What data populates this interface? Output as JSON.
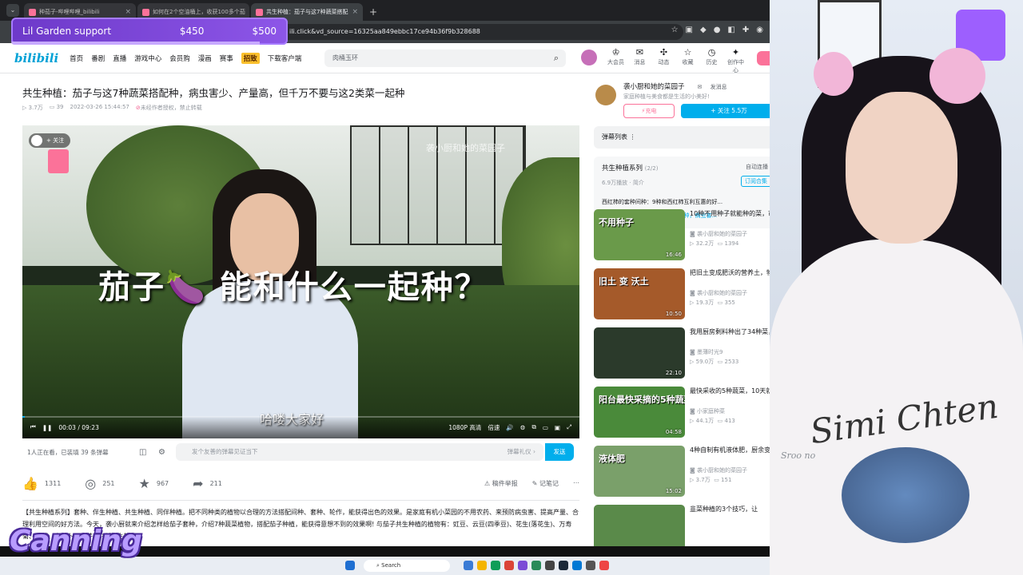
{
  "browser": {
    "tabs": [
      {
        "label": "种茄子-哔哩哔哩_bilibili"
      },
      {
        "label": "如何在2个空油桶上，收获100多个茄"
      },
      {
        "label": "共生种植：茄子与这7种蔬菜搭配"
      }
    ],
    "url": "ili.click&vd_source=16325aa849ebbc17ce94b36f9b328688"
  },
  "goal_overlay": {
    "label": "Lil Garden support",
    "current": "$450",
    "target": "$500",
    "progress": 0.9
  },
  "header": {
    "logo": "bilibili",
    "nav": [
      "首页",
      "番剧",
      "直播",
      "游戏中心",
      "会员购",
      "漫画",
      "赛事",
      "招致",
      "下载客户端"
    ],
    "search_placeholder": "肉桶玉环",
    "icons": [
      {
        "label": "大会员",
        "icon": "vip-icon"
      },
      {
        "label": "消息",
        "icon": "message-icon",
        "badge": "99+"
      },
      {
        "label": "动态",
        "icon": "dynamic-icon"
      },
      {
        "label": "收藏",
        "icon": "star-icon"
      },
      {
        "label": "历史",
        "icon": "history-icon"
      },
      {
        "label": "创作中心",
        "icon": "bulb-icon"
      }
    ]
  },
  "video": {
    "title": "共生种植：茄子与这7种蔬菜搭配种，病虫害少、产量高，但千万不要与这2类菜一起种",
    "views": "3.7万",
    "danmaku": "39",
    "date": "2022-03-26 15:44:57",
    "copyright": "未经作者授权，禁止转载",
    "caption": "茄子🍆 能和什么一起种？",
    "subtitle": "哈喽大家好",
    "watermark": "袭小厨和她的菜园子",
    "follow_label": "+ 关注",
    "time": "00:03 / 09:23",
    "progress": 0.005,
    "quality": "1080P 高清",
    "speed": "倍速"
  },
  "danmaku_bar": {
    "watching": "1人正在看，已装填 39 条弹幕",
    "placeholder": "发个友善的弹幕见证当下",
    "etiquette": "弹幕礼仪 ›",
    "send": "发送"
  },
  "actions": {
    "like": "1311",
    "coin": "251",
    "fav": "967",
    "share": "211",
    "report": "稿件举报",
    "notes": "记笔记"
  },
  "description": "【共生种植系列】套种、伴生种植、共生种植、同伴种植。把不同种类的植物以合理的方法搭配间种、套种、轮作，能获得出色的效果。是家庭有机小菜园的不用农药、来预防病虫害、提高产量、合理利用空间的好方法。今天，袭小厨就来介绍怎样给茄子套种，介绍7种蔬菜植物，搭配茄子种植，能获得意想不到的效果啊! 与茄子共生种植的植物有：豇豆、云豆(四季豆)、花生(落花生)、万寿菊、韭菜、白萝卜、欧芹(洋香菜)生姜。",
  "uploader": {
    "name": "袭小厨和她的菜园子",
    "message": "发消息",
    "desc": "家庭种植与美食都是生活的小美好!",
    "charge": "充电",
    "follow": "+ 关注 5.5万"
  },
  "danmaku_list": "弹幕列表",
  "series": {
    "title": "共生种植系列",
    "count": "(2/2)",
    "autoplay": "自动连播",
    "plays": "6.9万播放",
    "intro": "简介",
    "subscribe": "订阅合集",
    "episodes": [
      "西红柿的套种间种：9种和西红柿互利互惠的好...",
      "共生种植：茄子与这7种蔬菜搭配种，病虫害..."
    ]
  },
  "recommendations": [
    {
      "title": "10种不用种子就能种的菜，市买来的菜直接种，没有",
      "author": "袭小厨和她的菜园子",
      "views": "32.2万",
      "danmaku": "1394",
      "duration": "16:46",
      "thumb_text": "不用种子",
      "color": "#6a9a4a"
    },
    {
      "title": "把旧土变成肥沃的营养土，物利用，自制营养土",
      "author": "袭小厨和她的菜园子",
      "views": "19.3万",
      "danmaku": "355",
      "duration": "10:50",
      "thumb_text": "旧土 变 沃土",
      "color": "#a55a2a"
    },
    {
      "title": "我用厨房剩料种出了34种菜，不用买种子，吃剩的厨余",
      "author": "墨薄时光9",
      "views": "59.0万",
      "danmaku": "2533",
      "duration": "22:10",
      "thumb_text": "",
      "color": "#2b3a2b"
    },
    {
      "title": "最快采收的5种蔬菜，10天就可以吃上，阳台上也能",
      "author": "小家庭种菜",
      "views": "44.1万",
      "danmaku": "413",
      "duration": "04:58",
      "thumb_text": "阳台最快采摘的5种蔬菜",
      "color": "#4a8a3a"
    },
    {
      "title": "4种自制有机液体肥，厨余变废为宝，简单快速做有机",
      "author": "袭小厨和她的菜园子",
      "views": "3.7万",
      "danmaku": "151",
      "duration": "15:02",
      "thumb_text": "液体肥",
      "color": "#7aa06a"
    },
    {
      "title": "韭菜种植的3个技巧，让",
      "author": "",
      "views": "",
      "danmaku": "",
      "duration": "",
      "thumb_text": "",
      "color": "#5a8a4a"
    }
  ],
  "streamer": {
    "shirt_text": "Simi Chten",
    "label": "Sroo no"
  },
  "overlay_name": "Canning",
  "taskbar": {
    "search": "Search"
  }
}
